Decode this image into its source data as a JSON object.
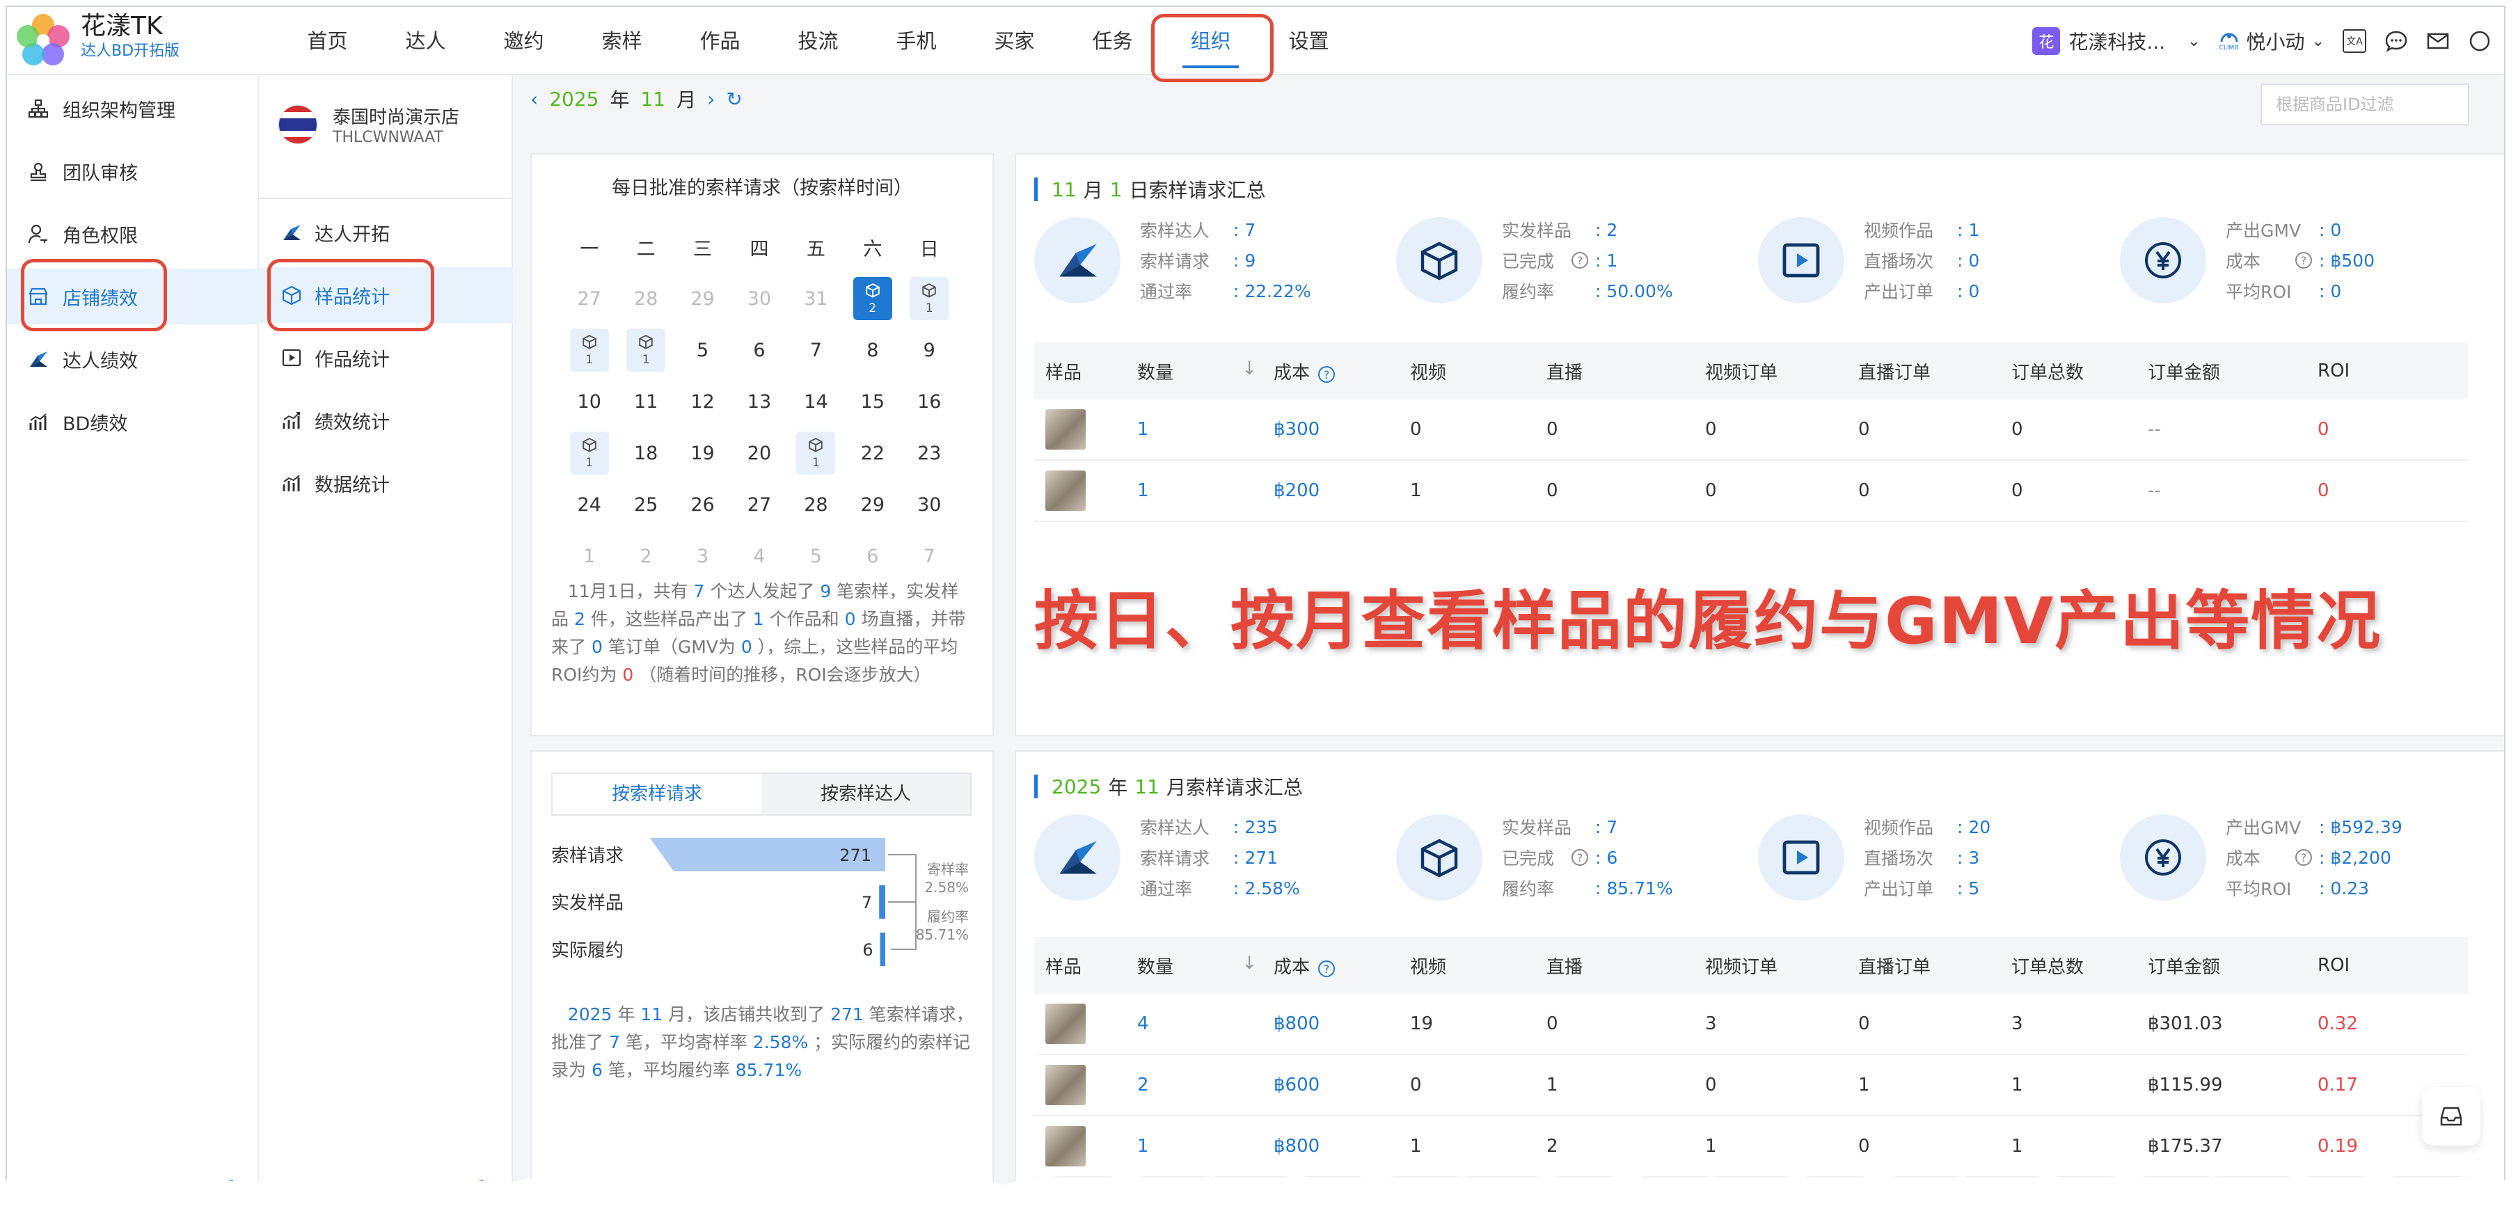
{
  "brand": {
    "name": "花漾TK",
    "subtitle": "达人BD开拓版"
  },
  "nav": [
    "首页",
    "达人",
    "邀约",
    "索样",
    "作品",
    "投流",
    "手机",
    "买家",
    "任务",
    "组织",
    "设置"
  ],
  "nav_active": "组织",
  "header_right": {
    "org": "花漾科技...",
    "org_badge": "花",
    "user": "悦小动",
    "user_sub": "CLIMB"
  },
  "sidebar": {
    "items": [
      {
        "label": "组织架构管理",
        "icon": "org-tree-icon"
      },
      {
        "label": "团队审核",
        "icon": "user-stamp-icon"
      },
      {
        "label": "角色权限",
        "icon": "user-key-icon"
      },
      {
        "label": "店铺绩效",
        "icon": "store-icon"
      },
      {
        "label": "达人绩效",
        "icon": "creator-icon"
      },
      {
        "label": "BD绩效",
        "icon": "chart-bars-icon"
      }
    ],
    "active": "店铺绩效"
  },
  "shop": {
    "name": "泰国时尚演示店",
    "id": "THLCWNWAAT"
  },
  "subnav": {
    "items": [
      {
        "label": "达人开拓",
        "icon": "creator-icon"
      },
      {
        "label": "样品统计",
        "icon": "box-icon"
      },
      {
        "label": "作品统计",
        "icon": "play-icon"
      },
      {
        "label": "绩效统计",
        "icon": "chart-line-icon"
      },
      {
        "label": "数据统计",
        "icon": "chart-bars-icon"
      }
    ],
    "active": "样品统计"
  },
  "month_bar": {
    "year": "2025",
    "year_unit": "年",
    "month": "11",
    "month_unit": "月"
  },
  "filter_placeholder": "根据商品ID过滤",
  "calendar": {
    "title": "每日批准的索样请求（按索样时间）",
    "weekdays": [
      "一",
      "二",
      "三",
      "四",
      "五",
      "六",
      "日"
    ],
    "weeks": [
      [
        {
          "d": "27",
          "dim": true
        },
        {
          "d": "28",
          "dim": true
        },
        {
          "d": "29",
          "dim": true
        },
        {
          "d": "30",
          "dim": true
        },
        {
          "d": "31",
          "dim": true
        },
        {
          "d": "1",
          "mark": "2",
          "sel": true
        },
        {
          "d": "2",
          "mark": "1"
        }
      ],
      [
        {
          "d": "3",
          "mark": "1"
        },
        {
          "d": "4",
          "mark": "1"
        },
        {
          "d": "5"
        },
        {
          "d": "6"
        },
        {
          "d": "7"
        },
        {
          "d": "8"
        },
        {
          "d": "9"
        }
      ],
      [
        {
          "d": "10"
        },
        {
          "d": "11"
        },
        {
          "d": "12"
        },
        {
          "d": "13"
        },
        {
          "d": "14"
        },
        {
          "d": "15"
        },
        {
          "d": "16"
        }
      ],
      [
        {
          "d": "17",
          "mark": "1"
        },
        {
          "d": "18"
        },
        {
          "d": "19"
        },
        {
          "d": "20"
        },
        {
          "d": "21",
          "mark": "1"
        },
        {
          "d": "22"
        },
        {
          "d": "23"
        }
      ],
      [
        {
          "d": "24"
        },
        {
          "d": "25"
        },
        {
          "d": "26"
        },
        {
          "d": "27"
        },
        {
          "d": "28"
        },
        {
          "d": "29"
        },
        {
          "d": "30"
        }
      ],
      [
        {
          "d": "1",
          "dim": true
        },
        {
          "d": "2",
          "dim": true
        },
        {
          "d": "3",
          "dim": true
        },
        {
          "d": "4",
          "dim": true
        },
        {
          "d": "5",
          "dim": true
        },
        {
          "d": "6",
          "dim": true
        },
        {
          "d": "7",
          "dim": true
        }
      ]
    ],
    "desc": {
      "p1": "11月1日，共有",
      "creators": "7",
      "p2": "个达人发起了",
      "requests": "9",
      "p3": "笔索样，实发样品",
      "samples": "2",
      "p4": "件，这些样品产出了",
      "videos": "1",
      "p5": "个作品和",
      "lives": "0",
      "p6": "场直播，并带来了",
      "orders": "0",
      "p7": "笔订单（GMV为",
      "gmv": "0",
      "p8": "），综上，这些样品的平均ROI约为",
      "roi": "0",
      "p9": "（随着时间的推移，ROI会逐步放大）"
    }
  },
  "daily_summary": {
    "month": "11",
    "month_unit": "月",
    "day": "1",
    "title_suffix": "日索样请求汇总",
    "groups": [
      {
        "icon": "creator-icon",
        "rows": [
          {
            "label": "索样达人",
            "value": ": 7"
          },
          {
            "label": "索样请求",
            "value": ": 9"
          },
          {
            "label": "通过率",
            "value": ": 22.22%"
          }
        ]
      },
      {
        "icon": "box-icon",
        "rows": [
          {
            "label": "实发样品",
            "value": ": 2"
          },
          {
            "label": "已完成",
            "value": ": 1",
            "help": true
          },
          {
            "label": "履约率",
            "value": ": 50.00%"
          }
        ]
      },
      {
        "icon": "play-icon",
        "rows": [
          {
            "label": "视频作品",
            "value": ": 1"
          },
          {
            "label": "直播场次",
            "value": ": 0"
          },
          {
            "label": "产出订单",
            "value": ": 0"
          }
        ]
      },
      {
        "icon": "yen-icon",
        "rows": [
          {
            "label": "产出GMV",
            "value": ": 0"
          },
          {
            "label": "成本",
            "value": ": ฿500",
            "help": true
          },
          {
            "label": "平均ROI",
            "value": ": 0",
            "red": true
          }
        ]
      }
    ],
    "table": {
      "headers": [
        "样品",
        "数量",
        "成本",
        "视频",
        "直播",
        "视频订单",
        "直播订单",
        "订单总数",
        "订单金额",
        "ROI"
      ],
      "rows": [
        {
          "qty": "1",
          "cost": "฿300",
          "video": "0",
          "live": "0",
          "vorders": "0",
          "lorders": "0",
          "total": "0",
          "amount": "--",
          "roi": "0"
        },
        {
          "qty": "1",
          "cost": "฿200",
          "video": "1",
          "live": "0",
          "vorders": "0",
          "lorders": "0",
          "total": "0",
          "amount": "--",
          "roi": "0"
        }
      ]
    }
  },
  "caption": "按日、按月查看样品的履约与GMV产出等情况",
  "monthly_summary": {
    "year": "2025",
    "year_unit": "年",
    "month": "11",
    "title_suffix": "月索样请求汇总",
    "groups": [
      {
        "icon": "creator-icon",
        "rows": [
          {
            "label": "索样达人",
            "value": ": 235"
          },
          {
            "label": "索样请求",
            "value": ": 271"
          },
          {
            "label": "通过率",
            "value": ": 2.58%"
          }
        ]
      },
      {
        "icon": "box-icon",
        "rows": [
          {
            "label": "实发样品",
            "value": ": 7"
          },
          {
            "label": "已完成",
            "value": ": 6",
            "help": true
          },
          {
            "label": "履约率",
            "value": ": 85.71%"
          }
        ]
      },
      {
        "icon": "play-icon",
        "rows": [
          {
            "label": "视频作品",
            "value": ": 20"
          },
          {
            "label": "直播场次",
            "value": ": 3"
          },
          {
            "label": "产出订单",
            "value": ": 5"
          }
        ]
      },
      {
        "icon": "yen-icon",
        "rows": [
          {
            "label": "产出GMV",
            "value": ": ฿592.39"
          },
          {
            "label": "成本",
            "value": ": ฿2,200",
            "help": true
          },
          {
            "label": "平均ROI",
            "value": ": 0.23",
            "red": true
          }
        ]
      }
    ],
    "table": {
      "headers": [
        "样品",
        "数量",
        "成本",
        "视频",
        "直播",
        "视频订单",
        "直播订单",
        "订单总数",
        "订单金额",
        "ROI"
      ],
      "rows": [
        {
          "qty": "4",
          "cost": "฿800",
          "video": "19",
          "live": "0",
          "vorders": "3",
          "lorders": "0",
          "total": "3",
          "amount": "฿301.03",
          "roi": "0.32"
        },
        {
          "qty": "2",
          "cost": "฿600",
          "video": "0",
          "live": "1",
          "vorders": "0",
          "lorders": "1",
          "total": "1",
          "amount": "฿115.99",
          "roi": "0.17"
        },
        {
          "qty": "1",
          "cost": "฿800",
          "video": "1",
          "live": "2",
          "vorders": "1",
          "lorders": "0",
          "total": "1",
          "amount": "฿175.37",
          "roi": "0.19"
        }
      ]
    }
  },
  "funnel": {
    "tabs": [
      "按索样请求",
      "按索样达人"
    ],
    "active_tab": "按索样请求",
    "stages": [
      {
        "label": "索样请求",
        "value": "271",
        "ratio": 1.0
      },
      {
        "label": "实发样品",
        "value": "7",
        "ratio": 0.026
      },
      {
        "label": "实际履约",
        "value": "6",
        "ratio": 0.022
      }
    ],
    "rates": [
      {
        "label": "寄样率",
        "value": "2.58%"
      },
      {
        "label": "履约率",
        "value": "85.71%"
      }
    ],
    "desc": {
      "year": "2025",
      "p1": "年",
      "month": "11",
      "p2": "月，该店铺共收到了",
      "requests": "271",
      "p3": "笔索样请求，批准了",
      "approved": "7",
      "p4": "笔，平均寄样率",
      "rate1": "2.58%",
      "p5": "；实际履约的索样记录为",
      "done": "6",
      "p6": "笔，平均履约率",
      "rate2": "85.71%"
    }
  }
}
